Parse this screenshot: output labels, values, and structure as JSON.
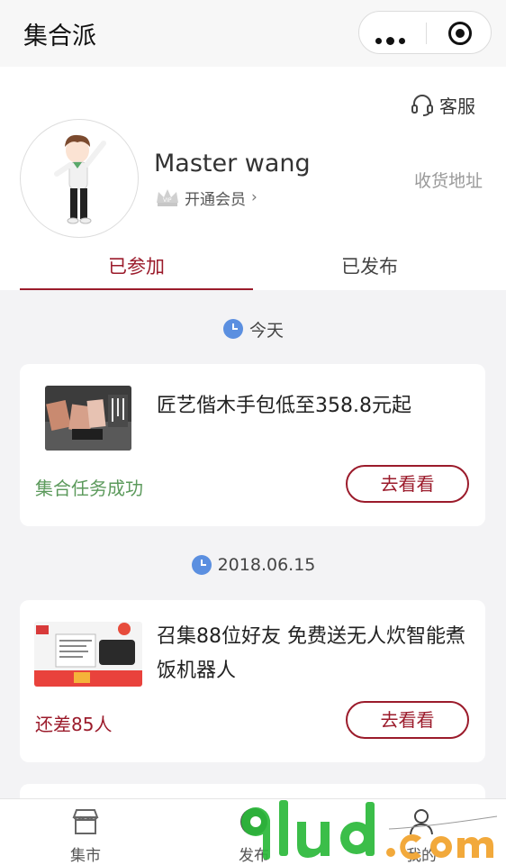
{
  "app": {
    "title": "集合派"
  },
  "profile": {
    "service_label": "客服",
    "username": "Master wang",
    "vip_label": "开通会员",
    "address_label": "收货地址"
  },
  "tabs": [
    {
      "label": "已参加",
      "active": true
    },
    {
      "label": "已发布",
      "active": false
    }
  ],
  "groups": [
    {
      "date": "今天",
      "item": {
        "title": "匠艺偕木手包低至358.8元起",
        "status": "集合任务成功",
        "action": "去看看"
      }
    },
    {
      "date": "2018.06.15",
      "item": {
        "title": "召集88位好友 免费送无人炊智能煮饭机器人",
        "status": "还差85人",
        "action": "去看看"
      }
    }
  ],
  "bottom_nav": [
    {
      "label": "集市",
      "icon": "store-icon"
    },
    {
      "label": "发布",
      "icon": "plus-icon"
    },
    {
      "label": "我的",
      "icon": "person-icon"
    }
  ],
  "colors": {
    "accent": "#9b1b2b",
    "success": "#5c9a5c",
    "clock": "#5b8fe0"
  }
}
